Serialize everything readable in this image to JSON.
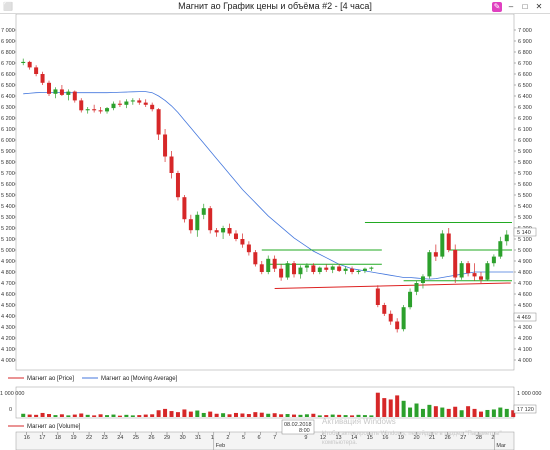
{
  "window": {
    "title": "Магнит ао График цены и объёма #2 - [4 часа]",
    "accent_color": "#e040c0"
  },
  "price_axis": {
    "ticks": [
      "7 000",
      "6 900",
      "6 800",
      "6 700",
      "6 600",
      "6 500",
      "6 400",
      "6 300",
      "6 200",
      "6 100",
      "6 000",
      "5 900",
      "5 800",
      "5 700",
      "5 600",
      "5 500",
      "5 400",
      "5 300",
      "5 200",
      "5 100",
      "5 000",
      "4 900",
      "4 800",
      "4 700",
      "4 600",
      "4 500",
      "4 400",
      "4 300",
      "4 200",
      "4 100",
      "4 000"
    ],
    "min": 4000,
    "max": 7000,
    "last_price_label": "5 140",
    "low_label": "4 469"
  },
  "volume_axis": {
    "ticks": [
      "1 000 000",
      "0"
    ],
    "last_volume_label": "17 120"
  },
  "date_axis": {
    "labels": [
      {
        "text": "16",
        "i": 3
      },
      {
        "text": "17",
        "i": 10
      },
      {
        "text": "18",
        "i": 17
      },
      {
        "text": "19",
        "i": 24
      },
      {
        "text": "22",
        "i": 31
      },
      {
        "text": "23",
        "i": 38
      },
      {
        "text": "24",
        "i": 45
      },
      {
        "text": "25",
        "i": 52
      },
      {
        "text": "26",
        "i": 59
      },
      {
        "text": "29",
        "i": 66
      },
      {
        "text": "30",
        "i": 73
      },
      {
        "text": "31",
        "i": 80
      },
      {
        "text": "1",
        "i": 87
      },
      {
        "text": "2",
        "i": 94
      },
      {
        "text": "5",
        "i": 101
      },
      {
        "text": "6",
        "i": 108
      },
      {
        "text": "7",
        "i": 115
      },
      {
        "text": "9",
        "i": 129
      },
      {
        "text": "12",
        "i": 136
      },
      {
        "text": "13",
        "i": 143
      },
      {
        "text": "14",
        "i": 150
      },
      {
        "text": "15",
        "i": 157
      },
      {
        "text": "16",
        "i": 164
      },
      {
        "text": "19",
        "i": 171
      },
      {
        "text": "20",
        "i": 178
      },
      {
        "text": "21",
        "i": 185
      },
      {
        "text": "26",
        "i": 192
      },
      {
        "text": "27",
        "i": 199
      },
      {
        "text": "28",
        "i": 206
      },
      {
        "text": "2",
        "i": 213
      }
    ],
    "months": [
      {
        "text": "Feb",
        "i": 87
      },
      {
        "text": "Mar",
        "i": 213
      }
    ],
    "cursor_date": "08.02.2018",
    "cursor_time": "8:00"
  },
  "legend": {
    "price_label": "Магнит ао [Price]",
    "ma_label": "Магнит ао [Moving Average]",
    "volume_label": "Магнит ао [Volume]"
  },
  "watermark": {
    "line1": "Активация Windows",
    "line2": "Чтобы активировать Windows, перейдите в раздел \"Параметры\"",
    "line3": "компьютера."
  },
  "chart_data": {
    "type": "candlestick",
    "ylim": [
      4000,
      7000
    ],
    "colors": {
      "up": "#2ca02c",
      "down": "#d62728",
      "ma": "#4477dd",
      "support": "#dd2222",
      "resistance": "#22aa22"
    },
    "candles": [
      [
        6700,
        6740,
        6680,
        6710
      ],
      [
        6710,
        6720,
        6640,
        6660
      ],
      [
        6660,
        6680,
        6580,
        6600
      ],
      [
        6600,
        6620,
        6500,
        6520
      ],
      [
        6520,
        6540,
        6400,
        6420
      ],
      [
        6420,
        6480,
        6380,
        6460
      ],
      [
        6460,
        6500,
        6400,
        6410
      ],
      [
        6410,
        6460,
        6360,
        6440
      ],
      [
        6440,
        6450,
        6340,
        6360
      ],
      [
        6360,
        6380,
        6250,
        6270
      ],
      [
        6270,
        6300,
        6240,
        6280
      ],
      [
        6280,
        6320,
        6250,
        6270
      ],
      [
        6270,
        6300,
        6240,
        6260
      ],
      [
        6260,
        6300,
        6240,
        6290
      ],
      [
        6290,
        6350,
        6270,
        6330
      ],
      [
        6330,
        6360,
        6300,
        6320
      ],
      [
        6320,
        6370,
        6290,
        6350
      ],
      [
        6350,
        6380,
        6320,
        6360
      ],
      [
        6360,
        6380,
        6320,
        6340
      ],
      [
        6340,
        6370,
        6300,
        6320
      ],
      [
        6320,
        6340,
        6260,
        6280
      ],
      [
        6280,
        6290,
        6000,
        6050
      ],
      [
        6050,
        6100,
        5800,
        5850
      ],
      [
        5850,
        5900,
        5650,
        5700
      ],
      [
        5700,
        5720,
        5450,
        5480
      ],
      [
        5480,
        5500,
        5250,
        5280
      ],
      [
        5280,
        5320,
        5150,
        5180
      ],
      [
        5180,
        5350,
        5120,
        5320
      ],
      [
        5320,
        5420,
        5280,
        5380
      ],
      [
        5380,
        5400,
        5150,
        5180
      ],
      [
        5180,
        5200,
        5120,
        5160
      ],
      [
        5160,
        5220,
        5100,
        5200
      ],
      [
        5200,
        5240,
        5130,
        5150
      ],
      [
        5150,
        5180,
        5080,
        5100
      ],
      [
        5100,
        5150,
        5020,
        5050
      ],
      [
        5050,
        5080,
        4950,
        4980
      ],
      [
        4980,
        5000,
        4850,
        4870
      ],
      [
        4870,
        4900,
        4780,
        4800
      ],
      [
        4800,
        4950,
        4780,
        4920
      ],
      [
        4920,
        4950,
        4800,
        4830
      ],
      [
        4830,
        4870,
        4720,
        4750
      ],
      [
        4750,
        4900,
        4730,
        4880
      ],
      [
        4880,
        4900,
        4750,
        4780
      ],
      [
        4780,
        4860,
        4740,
        4840
      ],
      [
        4840,
        4880,
        4800,
        4860
      ],
      [
        4860,
        4880,
        4780,
        4800
      ],
      [
        4800,
        4850,
        4780,
        4840
      ],
      [
        4840,
        4870,
        4800,
        4820
      ],
      [
        4820,
        4860,
        4790,
        4850
      ],
      [
        4850,
        4870,
        4800,
        4810
      ],
      [
        4810,
        4850,
        4780,
        4830
      ],
      [
        4830,
        4850,
        4780,
        4800
      ],
      [
        4800,
        4820,
        4780,
        4810
      ],
      [
        4810,
        4840,
        4790,
        4830
      ],
      [
        4830,
        4850,
        4810,
        4840
      ],
      [
        4650,
        4680,
        4480,
        4500
      ],
      [
        4500,
        4520,
        4400,
        4420
      ],
      [
        4420,
        4450,
        4320,
        4350
      ],
      [
        4350,
        4380,
        4250,
        4280
      ],
      [
        4280,
        4500,
        4260,
        4480
      ],
      [
        4480,
        4650,
        4460,
        4620
      ],
      [
        4620,
        4720,
        4590,
        4700
      ],
      [
        4700,
        4780,
        4650,
        4760
      ],
      [
        4760,
        5000,
        4740,
        4980
      ],
      [
        4980,
        5050,
        4900,
        4940
      ],
      [
        4940,
        5180,
        4920,
        5150
      ],
      [
        5150,
        5200,
        4980,
        5000
      ],
      [
        5000,
        5050,
        4700,
        4750
      ],
      [
        4750,
        4900,
        4730,
        4880
      ],
      [
        4880,
        4900,
        4760,
        4790
      ],
      [
        4790,
        4880,
        4720,
        4760
      ],
      [
        4760,
        4800,
        4700,
        4730
      ],
      [
        4730,
        4900,
        4720,
        4880
      ],
      [
        4880,
        4960,
        4850,
        4940
      ],
      [
        4940,
        5120,
        4920,
        5080
      ],
      [
        5080,
        5180,
        5040,
        5140
      ]
    ],
    "moving_average": [
      6420,
      6425,
      6430,
      6432,
      6432,
      6432,
      6430,
      6430,
      6430,
      6430,
      6430,
      6430,
      6430,
      6430,
      6432,
      6434,
      6436,
      6438,
      6440,
      6440,
      6430,
      6400,
      6360,
      6310,
      6250,
      6180,
      6110,
      6040,
      5970,
      5900,
      5830,
      5760,
      5690,
      5620,
      5550,
      5490,
      5430,
      5370,
      5310,
      5260,
      5210,
      5160,
      5110,
      5070,
      5030,
      4990,
      4960,
      4930,
      4900,
      4870,
      4850,
      4830,
      4820,
      4810,
      4800,
      4790,
      4780,
      4770,
      4760,
      4750,
      4750,
      4745,
      4740,
      4735,
      4740,
      4750,
      4760,
      4770,
      4780,
      4790,
      4800,
      4800,
      4800,
      4800,
      4800,
      4800,
      4800
    ],
    "volume": [
      120000,
      90000,
      80000,
      150000,
      110000,
      70000,
      100000,
      60000,
      90000,
      130000,
      80000,
      60000,
      100000,
      70000,
      90000,
      50000,
      80000,
      60000,
      70000,
      90000,
      100000,
      250000,
      300000,
      220000,
      180000,
      280000,
      200000,
      240000,
      150000,
      200000,
      120000,
      140000,
      100000,
      150000,
      130000,
      110000,
      180000,
      160000,
      120000,
      140000,
      100000,
      110000,
      90000,
      80000,
      100000,
      120000,
      60000,
      70000,
      90000,
      80000,
      70000,
      60000,
      80000,
      70000,
      60000,
      900000,
      700000,
      650000,
      800000,
      600000,
      350000,
      500000,
      300000,
      450000,
      400000,
      350000,
      300000,
      380000,
      250000,
      400000,
      300000,
      200000,
      260000,
      280000,
      350000,
      300000,
      250000
    ],
    "support_line": {
      "value": 4650,
      "value_end": 4700
    },
    "resistance_lines": [
      {
        "value": 5000,
        "from": 37,
        "to": 55
      },
      {
        "value": 4870,
        "from": 38,
        "to": 55
      },
      {
        "value": 5250,
        "from": 53,
        "to": 77
      },
      {
        "value": 5000,
        "from": 66,
        "to": 77
      },
      {
        "value": 4720,
        "from": 59,
        "to": 77
      }
    ]
  }
}
